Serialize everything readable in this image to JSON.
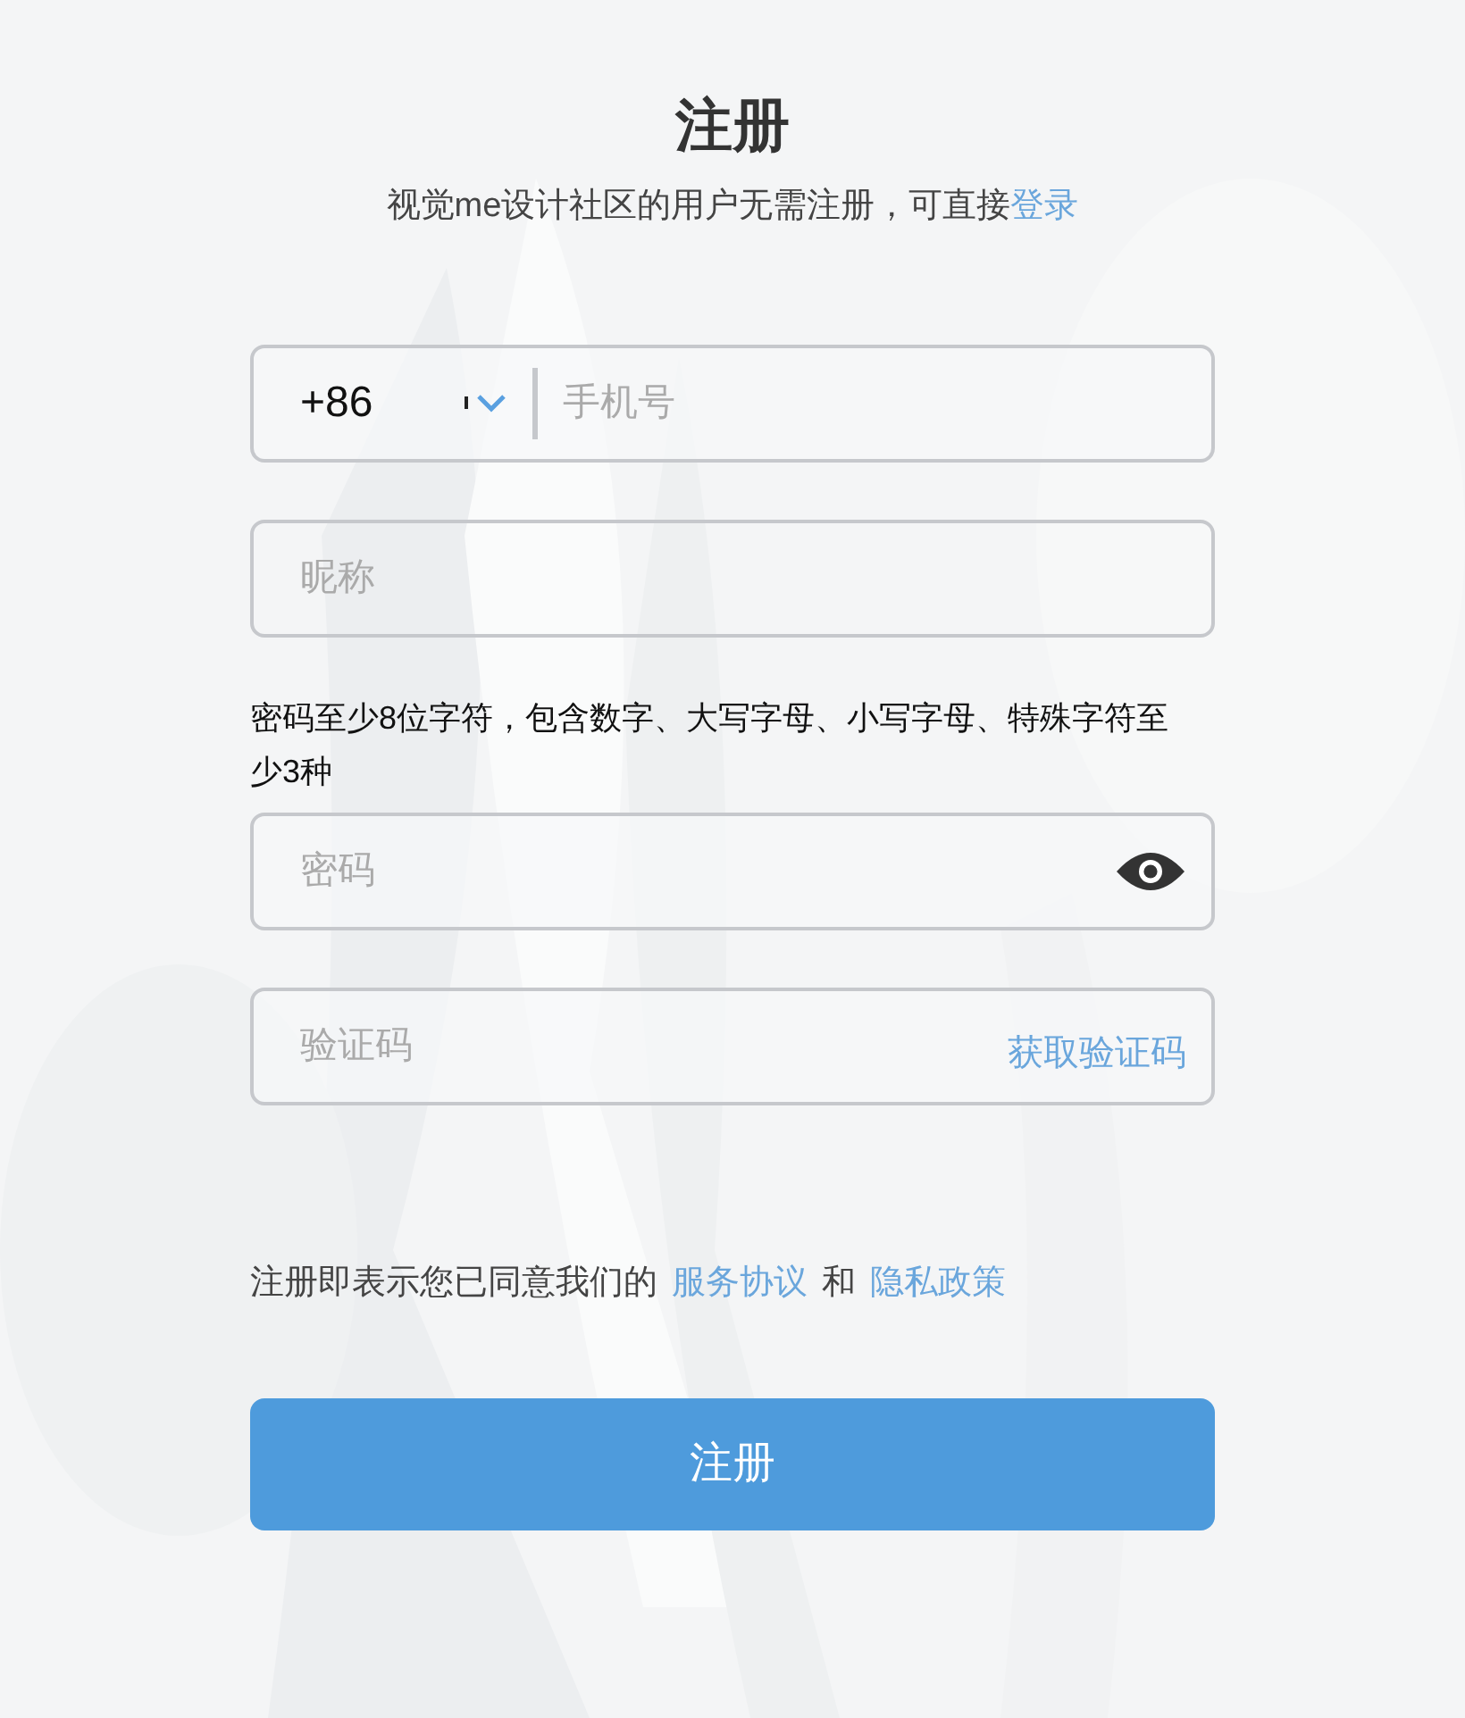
{
  "title": "注册",
  "subtitle": {
    "text": "视觉me设计社区的用户无需注册，可直接",
    "link": "登录"
  },
  "phone": {
    "country_code": "+86",
    "placeholder": "手机号"
  },
  "nickname": {
    "placeholder": "昵称"
  },
  "password_hint": "密码至少8位字符，包含数字、大写字母、小写字母、特殊字符至少3种",
  "password": {
    "placeholder": "密码"
  },
  "code": {
    "placeholder": "验证码",
    "action": "获取验证码"
  },
  "agreement": {
    "prefix": "注册即表示您已同意我们的",
    "terms": "服务协议",
    "and": "和",
    "privacy": "隐私政策"
  },
  "submit": "注册"
}
